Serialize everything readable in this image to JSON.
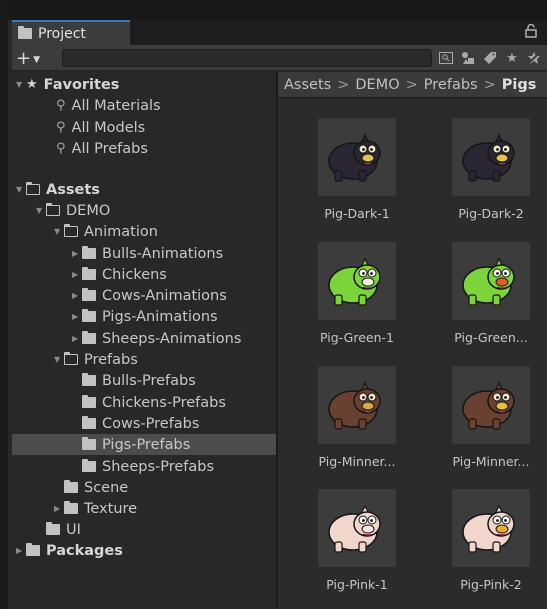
{
  "window": {
    "tab_label": "Project",
    "tab_icon": "folder-icon",
    "lock_icon": "lock-icon"
  },
  "toolbar": {
    "add_label": "+",
    "search_placeholder": "",
    "icons": [
      "search-filter-icon",
      "type-filter-icon",
      "label-filter-icon",
      "favorite-star-icon",
      "hidden-packages-icon"
    ]
  },
  "tree": {
    "favorites": {
      "label": "Favorites",
      "items": [
        "All Materials",
        "All Models",
        "All Prefabs"
      ]
    },
    "assets_label": "Assets",
    "demo_label": "DEMO",
    "animation_label": "Animation",
    "animation_children": [
      "Bulls-Animations",
      "Chickens",
      "Cows-Animations",
      "Pigs-Animations",
      "Sheeps-Animations"
    ],
    "prefabs_label": "Prefabs",
    "prefabs_children": [
      "Bulls-Prefabs",
      "Chickens-Prefabs",
      "Cows-Prefabs",
      "Pigs-Prefabs",
      "Sheeps-Prefabs"
    ],
    "scene_label": "Scene",
    "texture_label": "Texture",
    "ui_label": "UI",
    "packages_label": "Packages",
    "selected": "Pigs-Prefabs"
  },
  "breadcrumb": {
    "items": [
      "Assets",
      "DEMO",
      "Prefabs"
    ],
    "current": "Pigs"
  },
  "assets": [
    {
      "label": "Pig-Dark-1",
      "color": "#2b2633",
      "accent": "#e3c448"
    },
    {
      "label": "Pig-Dark-2",
      "color": "#2b2633",
      "accent": "#e3c448"
    },
    {
      "label": "Pig-Green-1",
      "color": "#7dd43a",
      "accent": "#f3f3e0"
    },
    {
      "label": "Pig-Green...",
      "color": "#7dd43a",
      "accent": "#e85a20"
    },
    {
      "label": "Pig-Minner...",
      "color": "#6a4030",
      "accent": "#d8a848"
    },
    {
      "label": "Pig-Minner...",
      "color": "#6a4030",
      "accent": "#e8c030"
    },
    {
      "label": "Pig-Pink-1",
      "color": "#f2d6cc",
      "accent": "#f0e8e0"
    },
    {
      "label": "Pig-Pink-2",
      "color": "#f2d6cc",
      "accent": "#e8b020"
    }
  ],
  "colors": {
    "accent_tab": "#3a79bb",
    "selection": "#4c4c4c"
  }
}
